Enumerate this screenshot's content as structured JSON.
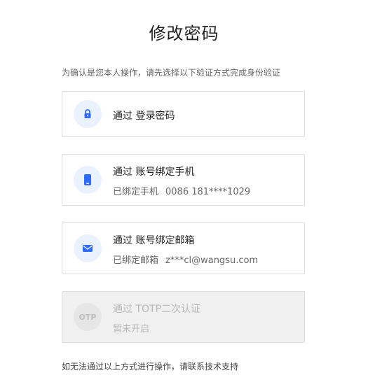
{
  "page": {
    "title": "修改密码",
    "hint": "为确认是您本人操作，请先选择以下验证方式完成身份验证",
    "footer": "如无法通过以上方式进行操作，请联系技术支持"
  },
  "colors": {
    "accent": "#2f6bff",
    "icon_bg": "#eaf1ff",
    "disabled_bg": "#f0f0f0"
  },
  "options": {
    "password": {
      "title": "通过 登录密码",
      "icon": "lock-icon"
    },
    "phone": {
      "title": "通过 账号绑定手机",
      "sub_label": "已绑定手机",
      "sub_value": "0086 181****1029",
      "icon": "phone-icon"
    },
    "email": {
      "title": "通过 账号绑定邮箱",
      "sub_label": "已绑定邮箱",
      "sub_value": "z***cl@wangsu.com",
      "icon": "mail-icon"
    },
    "totp": {
      "title": "通过 TOTP二次认证",
      "sub_label": "暂未开启",
      "icon_text": "OTP"
    }
  }
}
